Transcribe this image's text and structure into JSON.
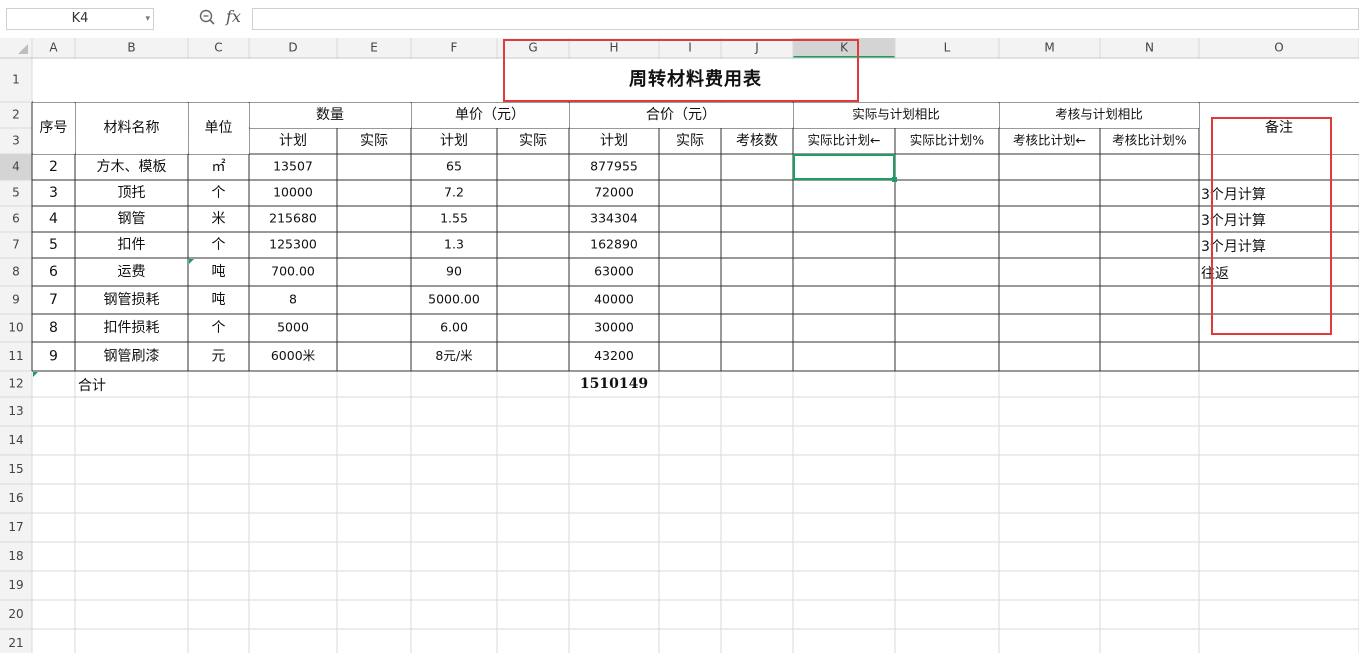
{
  "formula_bar": {
    "name_box": "K4",
    "fx_label": "fx",
    "formula": ""
  },
  "columns": [
    "A",
    "B",
    "C",
    "D",
    "E",
    "F",
    "G",
    "H",
    "I",
    "J",
    "K",
    "L",
    "M",
    "N",
    "O"
  ],
  "rows": [
    "1",
    "2",
    "3",
    "4",
    "5",
    "6",
    "7",
    "8",
    "9",
    "10",
    "11",
    "12",
    "13",
    "14",
    "15",
    "16",
    "17",
    "18",
    "19",
    "20",
    "21"
  ],
  "selected_cell": "K4",
  "table": {
    "title": "周转材料费用表",
    "headers": {
      "seq": "序号",
      "name": "材料名称",
      "unit": "单位",
      "qty": "数量",
      "price": "单价（元）",
      "total": "合价（元）",
      "actual_vs_plan": "实际与计划相比",
      "assess_vs_plan": "考核与计划相比",
      "remark": "备注",
      "plan1": "计划",
      "actual1": "实际",
      "plan2": "计划",
      "actual2": "实际",
      "plan3": "计划",
      "actual3": "实际",
      "assess": "考核数",
      "ratio1": "实际比计划←",
      "ratio2": "实际比计划%",
      "ratio3": "考核比计划←",
      "ratio4": "考核比计划%"
    },
    "rows": [
      {
        "seq": "2",
        "name": "方木、模板",
        "unit": "㎡",
        "qty_plan": "13507",
        "price_plan": "65",
        "total_plan": "877955",
        "remark": ""
      },
      {
        "seq": "3",
        "name": "顶托",
        "unit": "个",
        "qty_plan": "10000",
        "price_plan": "7.2",
        "total_plan": "72000",
        "remark": "3个月计算"
      },
      {
        "seq": "4",
        "name": "钢管",
        "unit": "米",
        "qty_plan": "215680",
        "price_plan": "1.55",
        "total_plan": "334304",
        "remark": "3个月计算"
      },
      {
        "seq": "5",
        "name": "扣件",
        "unit": "个",
        "qty_plan": "125300",
        "price_plan": "1.3",
        "total_plan": "162890",
        "remark": "3个月计算"
      },
      {
        "seq": "6",
        "name": "运费",
        "unit": "吨",
        "qty_plan": "700.00",
        "price_plan": "90",
        "total_plan": "63000",
        "remark": "往返"
      },
      {
        "seq": "7",
        "name": "钢管损耗",
        "unit": "吨",
        "qty_plan": "8",
        "price_plan": "5000.00",
        "total_plan": "40000",
        "remark": ""
      },
      {
        "seq": "8",
        "name": "扣件损耗",
        "unit": "个",
        "qty_plan": "5000",
        "price_plan": "6.00",
        "total_plan": "30000",
        "remark": ""
      },
      {
        "seq": "9",
        "name": "钢管刷漆",
        "unit": "元",
        "qty_plan": "6000米",
        "price_plan": "8元/米",
        "total_plan": "43200",
        "remark": ""
      }
    ],
    "total_row": {
      "label": "合计",
      "total_plan": "1510149"
    }
  },
  "colors": {
    "grid": "#d9d9d9",
    "border": "#333333",
    "annotation_red": "#e03a3a",
    "selection_green": "#1e9e62",
    "header_bg": "#f3f3f3",
    "selected_header_bg": "#d4d4d4"
  }
}
